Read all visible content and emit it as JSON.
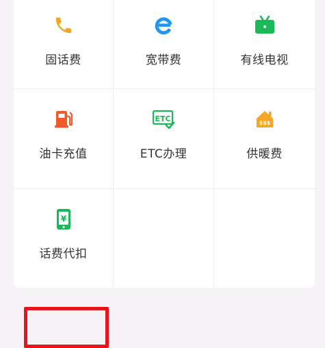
{
  "services": [
    {
      "label": "固话费",
      "icon": "phone-icon",
      "color": "#f5a623"
    },
    {
      "label": "宽带费",
      "icon": "ie-broadband-icon",
      "color": "#2196f3"
    },
    {
      "label": "有线电视",
      "icon": "tv-icon",
      "color": "#19b955"
    },
    {
      "label": "油卡充值",
      "icon": "gas-station-icon",
      "color": "#f05a28"
    },
    {
      "label": "ETC办理",
      "icon": "etc-icon",
      "color": "#19b955"
    },
    {
      "label": "供暖费",
      "icon": "heating-icon",
      "color": "#f5a623"
    },
    {
      "label": "话费代扣",
      "icon": "phone-yuan-icon",
      "color": "#19b955"
    }
  ],
  "etc_icon_text": "ETC",
  "heating_icon_text": "$$$",
  "phone_yuan_text": "¥",
  "highlight_color": "#e8141c"
}
